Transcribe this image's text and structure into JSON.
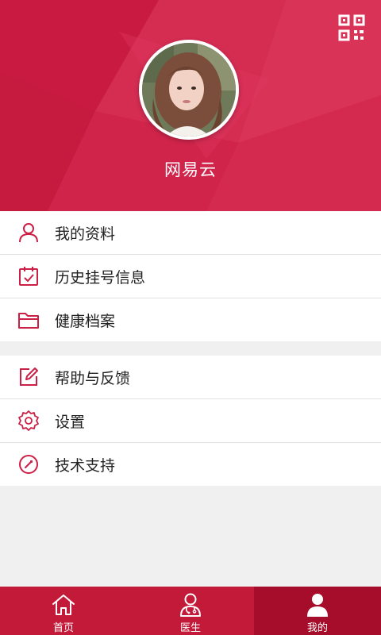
{
  "profile": {
    "username": "网易云"
  },
  "menu_group_1": [
    {
      "label": "我的资料",
      "icon": "user-icon"
    },
    {
      "label": "历史挂号信息",
      "icon": "calendar-check-icon"
    },
    {
      "label": "健康档案",
      "icon": "folder-icon"
    }
  ],
  "menu_group_2": [
    {
      "label": "帮助与反馈",
      "icon": "edit-icon"
    },
    {
      "label": "设置",
      "icon": "gear-icon"
    },
    {
      "label": "技术支持",
      "icon": "compass-icon"
    }
  ],
  "tabs": [
    {
      "label": "首页",
      "icon": "home-icon",
      "active": false
    },
    {
      "label": "医生",
      "icon": "doctor-icon",
      "active": false
    },
    {
      "label": "我的",
      "icon": "person-icon",
      "active": true
    }
  ],
  "colors": {
    "primary": "#cc1f45",
    "tab_bar": "#c41a3a",
    "tab_active": "#a50d2a",
    "icon_accent": "#cc1f45"
  }
}
